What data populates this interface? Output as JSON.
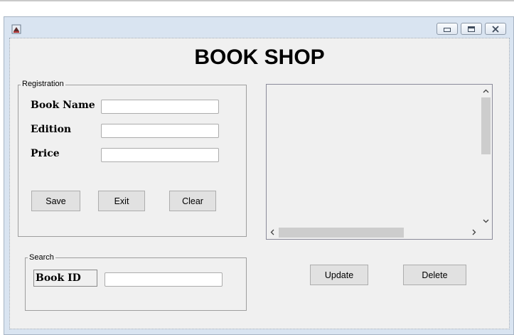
{
  "window": {
    "app_icon": "java-cup-icon",
    "controls": {
      "minimize": "minimize-icon",
      "maximize": "maximize-icon",
      "close": "close-icon"
    }
  },
  "title": "BOOK SHOP",
  "registration": {
    "legend": "Registration",
    "fields": [
      {
        "label": "Book Name",
        "value": ""
      },
      {
        "label": "Edition",
        "value": ""
      },
      {
        "label": "Price",
        "value": ""
      }
    ],
    "buttons": {
      "save": "Save",
      "exit": "Exit",
      "clear": "Clear"
    }
  },
  "search": {
    "legend": "Search",
    "label": "Book ID",
    "value": ""
  },
  "actions": {
    "update": "Update",
    "delete": "Delete"
  },
  "scroll_icons": {
    "up": "chevron-up-icon",
    "down": "chevron-down-icon",
    "left": "chevron-left-icon",
    "right": "chevron-right-icon"
  }
}
